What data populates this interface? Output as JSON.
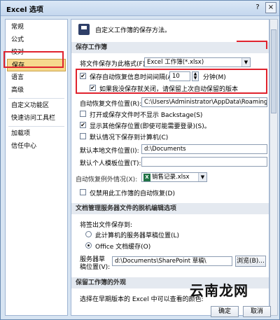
{
  "window": {
    "title": "Excel 选项",
    "help": "?",
    "close": "×"
  },
  "sidebar": {
    "items": [
      {
        "label": "常规"
      },
      {
        "label": "公式"
      },
      {
        "label": "校对"
      },
      {
        "label": "保存"
      },
      {
        "label": "语言"
      },
      {
        "label": "高级"
      },
      {
        "label": "自定义功能区"
      },
      {
        "label": "快速访问工具栏"
      },
      {
        "label": "加载项"
      },
      {
        "label": "信任中心"
      }
    ],
    "active_index": 3
  },
  "main": {
    "header": "自定义工作簿的保存方法。",
    "sections": {
      "save_workbooks": "保存工作簿",
      "autorecover_exceptions": "自动恢复例外情况(X):",
      "offline_editing": "文档管理服务器文件的脱机编辑选项",
      "preserve_appearance": "保留工作簿的外观"
    },
    "save_format": {
      "label": "将文件保存为此格式(F):",
      "value": "Excel 工作簿(*.xlsx)"
    },
    "autorecover": {
      "label": "保存自动恢复信息时间间隔(A)",
      "minutes": "10",
      "unit": "分钟(M)",
      "checked": "✔"
    },
    "keep_last": {
      "label": "如果我没保存就关闭，请保留上次自动保留的版本",
      "checked": "✔"
    },
    "autorecover_location": {
      "label": "自动恢复文件位置(R):",
      "value": "C:\\Users\\Administrator\\AppData\\Roaming\\"
    },
    "no_backstage": {
      "label": "打开或保存文件时不显示 Backstage(S)"
    },
    "show_places": {
      "label": "显示其他保存位置(即使可能需要登录)(S)。",
      "checked": "✔"
    },
    "default_computer": {
      "label": "默认情况下保存到计算机(C)"
    },
    "default_local": {
      "label": "默认本地文件位置(I):",
      "value": "d:\\Documents"
    },
    "personal_templates": {
      "label": "默认个人模板位置(T):",
      "value": ""
    },
    "exception_workbook": "销售记录.xlsx",
    "disable_autorecover": "仅禁用此工作簿的自动恢复(D)",
    "checkout_label": "将签出文件保存到:",
    "server_drafts": "此计算机的服务器草稿位置(L)",
    "office_cache": "Office 文档缓存(O)",
    "server_drafts_location": {
      "label": "服务器草稿位置(V):",
      "value": "d:\\Documents\\SharePoint 草稿\\"
    },
    "browse": "浏览(B)...",
    "preserve_text": "选择在早期版本的 Excel 中可以查看的颜色:"
  },
  "footer": {
    "ok": "确定",
    "cancel": "取消"
  },
  "watermark": {
    "site": "云南龙网"
  }
}
